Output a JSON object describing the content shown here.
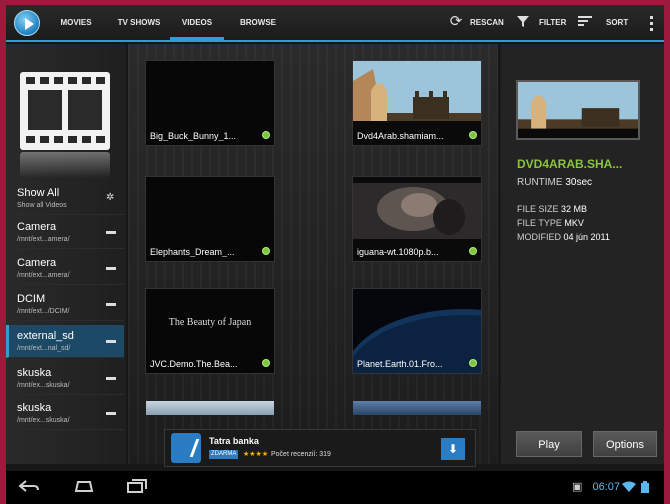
{
  "topbar": {
    "tabs": [
      {
        "label": "MOVIES"
      },
      {
        "label": "TV SHOWS"
      },
      {
        "label": "VIDEOS"
      },
      {
        "label": "BROWSE"
      }
    ],
    "active_tab": "VIDEOS",
    "actions": {
      "rescan": "RESCAN",
      "filter": "FILTER",
      "sort": "SORT"
    },
    "accent": "#2b9fd3"
  },
  "sidebar": {
    "items": [
      {
        "title": "Show All",
        "subtitle": "Show all Videos",
        "icon": "grid-icon"
      },
      {
        "title": "Camera",
        "subtitle": "/mnt/ext...amera/",
        "icon": "folder-icon"
      },
      {
        "title": "Camera",
        "subtitle": "/mnt/ext...amera/",
        "icon": "folder-icon"
      },
      {
        "title": "DCIM",
        "subtitle": "/mnt/ext.../DCIM/",
        "icon": "folder-icon"
      },
      {
        "title": "external_sd",
        "subtitle": "/mnt/ext...nal_sd/",
        "icon": "folder-icon",
        "selected": true
      },
      {
        "title": "skuska",
        "subtitle": "/mnt/ex...skuska/",
        "icon": "folder-icon"
      },
      {
        "title": "skuska",
        "subtitle": "/mnt/ex...skuska/",
        "icon": "folder-icon"
      }
    ]
  },
  "grid": {
    "tiles": [
      {
        "caption": "Big_Buck_Bunny_1...",
        "thumb": "black"
      },
      {
        "caption": "Dvd4Arab.shamiam...",
        "thumb": "castle"
      },
      {
        "caption": "Elephants_Dream_...",
        "thumb": "black"
      },
      {
        "caption": "iguana-wt.1080p.b...",
        "thumb": "face"
      },
      {
        "caption": "JVC.Demo.The.Bea...",
        "thumb": "text",
        "overlay": "The Beauty of Japan"
      },
      {
        "caption": "Planet.Earth.01.Fro...",
        "thumb": "earth"
      }
    ]
  },
  "ad": {
    "title": "Tatra banka",
    "badge": "ZDARMA",
    "stars": "★★★★",
    "reviews": "Počet recenzií: 319"
  },
  "detail": {
    "title": "DVD4ARAB.SHA...",
    "runtime_label": "RUNTIME",
    "runtime": "30sec",
    "filesize_label": "FILE SIZE",
    "filesize": "32 MB",
    "filetype_label": "FILE TYPE",
    "filetype": "MKV",
    "modified_label": "MODIFIED",
    "modified": "04 jún 2011",
    "play": "Play",
    "options": "Options",
    "title_color": "#8bc43f"
  },
  "status": {
    "time": "06:07"
  }
}
